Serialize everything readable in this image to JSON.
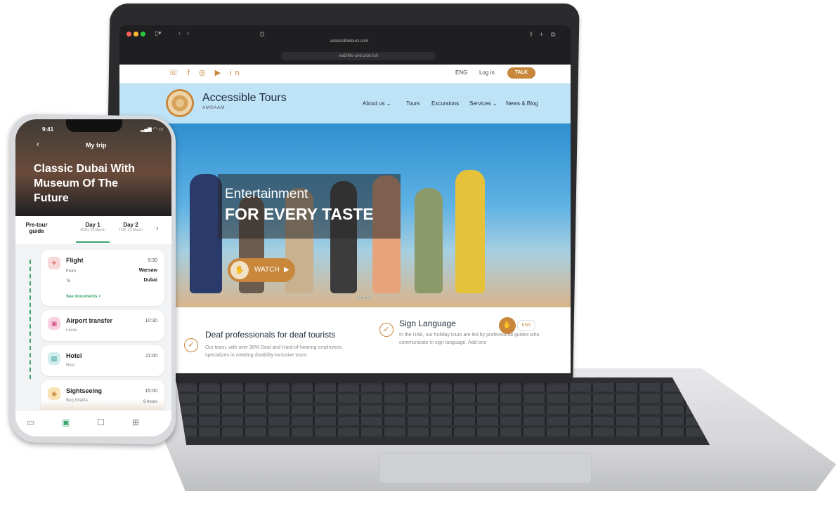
{
  "browser": {
    "url_top": "accessibletours.com",
    "url_pill": "wa5/Mo-ui/d.o/de.fo/t",
    "tab_letter": "D"
  },
  "website": {
    "topbar": {
      "social_icons": [
        "phone-icon",
        "facebook-icon",
        "instagram-icon",
        "youtube-icon",
        "linkedin-icon"
      ],
      "lang": "ENG",
      "login": "Log in",
      "talk": "TALK"
    },
    "header": {
      "brand": "Accessible Tours",
      "brand_sub": "AMSAAM",
      "nav": [
        "About us ⌄",
        "Tours",
        "Excursions",
        "Services ⌄",
        "News & Blog"
      ]
    },
    "hero": {
      "subtitle": "Entertainment",
      "title": "FOR EVERY TASTE",
      "watch_label": "WATCH"
    },
    "features": [
      {
        "title": "Deaf professionals for deaf tourists",
        "text": "Our team, with over 90% Deaf and Hard-of-hearing employees, specializes in creating disability-inclusive tours."
      },
      {
        "title": "Sign Language",
        "text": "In the UAE, our holiday tours are led by professional guides who communicate in sign language. Add-ons"
      }
    ],
    "float_pill": "ENG"
  },
  "phone": {
    "time": "9:41",
    "status": "▂▄▆ ◠ ▭",
    "screen_title": "My trip",
    "trip_title": "Classic Dubai With Museum Of The Future",
    "tabs": [
      {
        "label": "Pre-tour guide",
        "sub": ""
      },
      {
        "label": "Day 1",
        "sub": "MON, 20 March"
      },
      {
        "label": "Day 2",
        "sub": "TUE, 21 March"
      }
    ],
    "items": [
      {
        "title": "Flight",
        "time": "9:30",
        "from_label": "From",
        "from_val": "Warsaw",
        "to_label": "To",
        "to_val": "Dubai",
        "link": "See documents >"
      },
      {
        "title": "Airport transfer",
        "time": "10:30",
        "sub": "Lexus"
      },
      {
        "title": "Hotel",
        "time": "11:00",
        "sub": "Rest"
      },
      {
        "title": "Sightseeing",
        "time": "15:00",
        "sub": "Burj Khalifa",
        "duration": "6 hours"
      }
    ],
    "bottom_nav": [
      "camera-icon",
      "itinerary-icon",
      "chat-icon",
      "grid-icon"
    ]
  },
  "colors": {
    "accent": "#c8873b",
    "phone_green": "#3aa56b"
  }
}
